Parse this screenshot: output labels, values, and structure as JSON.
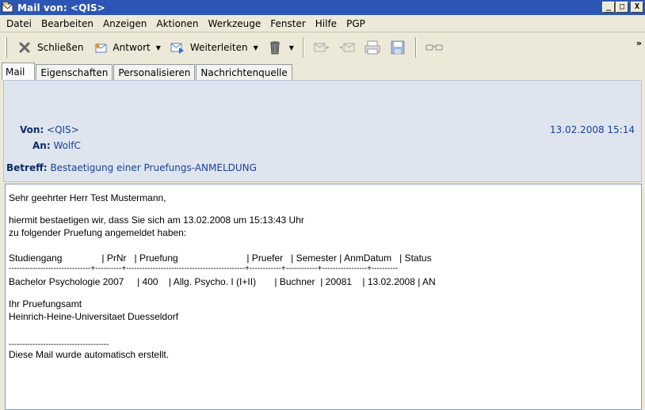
{
  "window": {
    "title": "Mail von: <QIS>",
    "min_glyph": "_",
    "max_glyph": "□",
    "close_glyph": "X"
  },
  "menu": [
    "Datei",
    "Bearbeiten",
    "Anzeigen",
    "Aktionen",
    "Werkzeuge",
    "Fenster",
    "Hilfe",
    "PGP"
  ],
  "toolbar": {
    "close_label": "Schließen",
    "reply_label": "Antwort",
    "forward_label": "Weiterleiten",
    "more_glyph": "»"
  },
  "tabs": [
    "Mail",
    "Eigenschaften",
    "Personalisieren",
    "Nachrichtenquelle"
  ],
  "header": {
    "from_label": "Von:",
    "from_value": "<QIS>",
    "date": "13.02.2008 15:14",
    "to_label": "An:",
    "to_value": "WolfC",
    "subject_label": "Betreff:",
    "subject_value": "Bestaetigung einer Pruefungs-ANMELDUNG"
  },
  "body": {
    "greeting": "Sehr geehrter Herr Test Mustermann,",
    "intro_1": "hiermit bestaetigen wir, dass Sie sich am 13.02.2008 um 15:13:43 Uhr",
    "intro_2": "zu folgender Pruefung angemeldet haben:",
    "table_header": "Studiengang               | PrNr   | Pruefung                          | Pruefer   | Semester | AnmDatum   | Status",
    "table_rule": "-------------------------------+----------+---------------------------------------------+------------+------------+-----------------+----------",
    "table_row": "Bachelor Psychologie 2007     | 400    | Allg. Psycho. I (I+II)       | Buchner  | 20081    | 13.02.2008 | AN",
    "sign_1": "Ihr Pruefungsamt",
    "sign_2": "Heinrich-Heine-Universitaet Duesseldorf",
    "footer_rule": "--------------------------------------",
    "footer": "Diese Mail wurde automatisch erstellt."
  }
}
